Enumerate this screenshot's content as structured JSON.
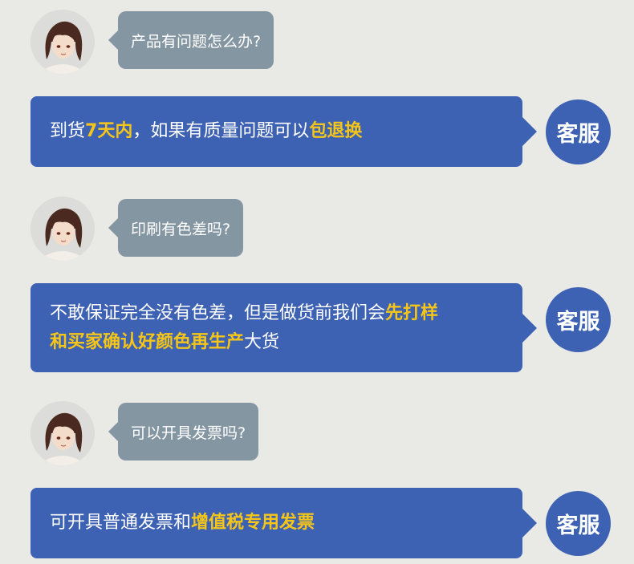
{
  "colors": {
    "background": "#e9e9e6",
    "question_bubble": "#8596a3",
    "answer_bubble": "#3e62b3",
    "highlight": "#f5c518"
  },
  "agent_label": "客服",
  "qa": [
    {
      "question": "产品有问题怎么办?",
      "answer_lines": [
        [
          {
            "t": "到货"
          },
          {
            "t": "7天内",
            "hl": true
          },
          {
            "t": "，如果有质量问题可以"
          },
          {
            "t": "包退换",
            "hl": true
          }
        ]
      ]
    },
    {
      "question": "印刷有色差吗?",
      "answer_lines": [
        [
          {
            "t": "不敢保证完全没有色差，但是做货前我们会"
          },
          {
            "t": "先打样",
            "hl": true
          }
        ],
        [
          {
            "t": "和买家确认好颜色再生产",
            "hl": true
          },
          {
            "t": "大货"
          }
        ]
      ]
    },
    {
      "question": "可以开具发票吗?",
      "answer_lines": [
        [
          {
            "t": "可开具普通发票和"
          },
          {
            "t": "增值税专用发票",
            "hl": true
          }
        ]
      ]
    }
  ]
}
